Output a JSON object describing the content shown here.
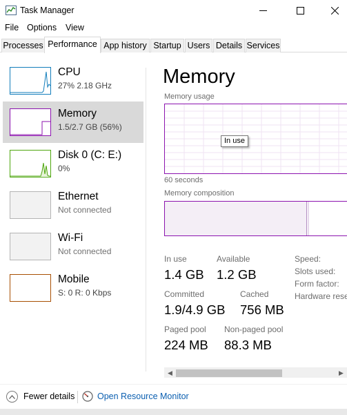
{
  "window": {
    "title": "Task Manager",
    "minimize_icon": "minimize-icon",
    "maximize_icon": "maximize-icon",
    "close_icon": "close-icon"
  },
  "menu": [
    "File",
    "Options",
    "View"
  ],
  "tabs": [
    {
      "label": "Processes",
      "active": false
    },
    {
      "label": "Performance",
      "active": true
    },
    {
      "label": "App history",
      "active": false
    },
    {
      "label": "Startup",
      "active": false
    },
    {
      "label": "Users",
      "active": false
    },
    {
      "label": "Details",
      "active": false
    },
    {
      "label": "Services",
      "active": false
    }
  ],
  "sidebar": {
    "items": [
      {
        "title": "CPU",
        "subtitle": "27%  2.18 GHz",
        "color": "#117dbb",
        "selected": false
      },
      {
        "title": "Memory",
        "subtitle": "1.5/2.7 GB (56%)",
        "color": "#8b12ae",
        "selected": true
      },
      {
        "title": "Disk 0 (C: E:)",
        "subtitle": "0%",
        "color": "#4da60c",
        "selected": false
      },
      {
        "title": "Ethernet",
        "subtitle": "Not connected",
        "color": "#a7a7a7",
        "selected": false
      },
      {
        "title": "Wi-Fi",
        "subtitle": "Not connected",
        "color": "#a7a7a7",
        "selected": false
      },
      {
        "title": "Mobile",
        "subtitle": "S: 0 R: 0 Kbps",
        "color": "#a74f01",
        "selected": false
      }
    ]
  },
  "main": {
    "title": "Memory",
    "usage_label": "Memory usage",
    "tooltip": "In use",
    "time_label": "60 seconds",
    "composition_label": "Memory composition",
    "composition_in_use_fraction": 0.74,
    "stats": {
      "in_use_label": "In use",
      "in_use_value": "1.4 GB",
      "available_label": "Available",
      "available_value": "1.2 GB",
      "committed_label": "Committed",
      "committed_value": "1.9/4.9 GB",
      "cached_label": "Cached",
      "cached_value": "756 MB",
      "paged_label": "Paged pool",
      "paged_value": "224 MB",
      "nonpaged_label": "Non-paged pool",
      "nonpaged_value": "88.3 MB"
    },
    "properties": [
      "Speed:",
      "Slots used:",
      "Form factor:",
      "Hardware rese"
    ]
  },
  "footer": {
    "fewer_details": "Fewer details",
    "resource_monitor": "Open Resource Monitor"
  },
  "colors": {
    "memory_accent": "#8b12ae",
    "link": "#0b5fb0"
  }
}
